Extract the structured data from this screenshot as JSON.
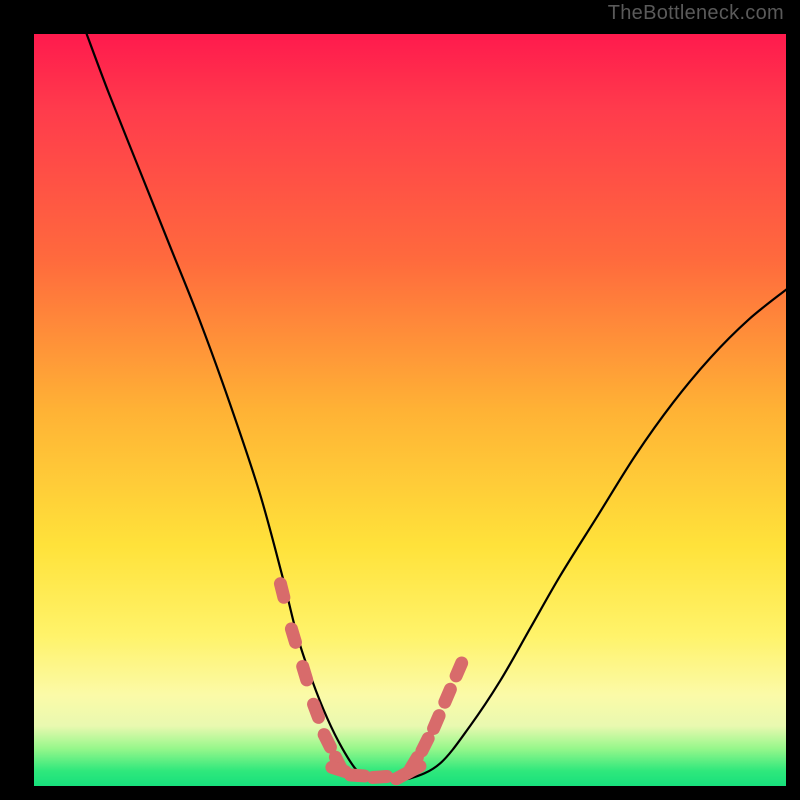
{
  "watermark": "TheBottleneck.com",
  "colors": {
    "curve": "#000000",
    "marker": "#d86b6b",
    "gradient_top": "#ff1a4d",
    "gradient_bottom": "#17e07c",
    "background": "#000000"
  },
  "chart_data": {
    "type": "line",
    "title": "",
    "xlabel": "",
    "ylabel": "",
    "xlim": [
      0,
      100
    ],
    "ylim": [
      0,
      100
    ],
    "grid": false,
    "legend": false,
    "note": "Axes unlabeled; values are normalized estimates read from plot-area pixel positions (0–100). y=100 top, y=0 bottom.",
    "series": [
      {
        "name": "bottleneck-curve",
        "x": [
          7,
          10,
          14,
          18,
          22,
          26,
          30,
          33,
          35,
          37,
          39,
          41,
          43,
          45,
          47,
          50,
          54,
          58,
          62,
          66,
          70,
          75,
          80,
          85,
          90,
          95,
          100
        ],
        "y": [
          100,
          92,
          82,
          72,
          62,
          51,
          39,
          28,
          20,
          14,
          9,
          5,
          2,
          1,
          1,
          1,
          3,
          8,
          14,
          21,
          28,
          36,
          44,
          51,
          57,
          62,
          66
        ]
      },
      {
        "name": "marker-left-descent",
        "x": [
          33,
          34.5,
          36,
          37.5,
          39,
          40.5
        ],
        "y": [
          26,
          20,
          15,
          10,
          6,
          3
        ]
      },
      {
        "name": "marker-bottom-flat",
        "x": [
          40.5,
          43,
          46,
          49,
          50.5
        ],
        "y": [
          2.2,
          1.4,
          1.2,
          1.4,
          2.2
        ]
      },
      {
        "name": "marker-right-ascent",
        "x": [
          50.5,
          52,
          53.5,
          55,
          56.5
        ],
        "y": [
          3,
          5.5,
          8.5,
          12,
          15.5
        ]
      }
    ]
  }
}
